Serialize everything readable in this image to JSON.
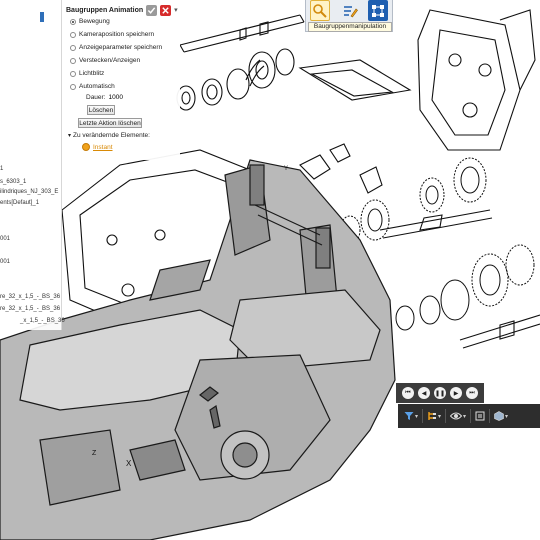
{
  "tree": {
    "rows": [
      "1",
      "s_6303_1",
      "ilindriques_NJ_303_E",
      "ents[Defaut]_1",
      "001",
      "001",
      "re_32_x_1,5_-_BS_36",
      "re_32_x_1,5_-_BS_36",
      "_x_1,5_-_BS_36"
    ]
  },
  "animation_panel": {
    "title": "Baugruppen Animation",
    "options": [
      {
        "label": "Bewegung",
        "selected": true
      },
      {
        "label": "Kameraposition speichern",
        "selected": false
      },
      {
        "label": "Anzeigeparameter speichern",
        "selected": false
      },
      {
        "label": "Verstecken/Anzeigen",
        "selected": false
      },
      {
        "label": "Lichtblitz",
        "selected": false
      },
      {
        "label": "Automatisch",
        "selected": false
      }
    ],
    "duration_label": "Dauer:",
    "duration_value": "1000",
    "delete_label": "Löschen",
    "undo_label": "Letzte Aktion löschen",
    "elements_label": "Zu verändernde Elemente:",
    "instant_label": "Instant"
  },
  "manipulation": {
    "tooltip": "Baugruppenmanipulation",
    "buttons": [
      "search-move-icon",
      "edit-list-icon",
      "assembly-grid-icon"
    ]
  },
  "playback": {
    "buttons": [
      "skip-back",
      "rewind",
      "pause",
      "forward",
      "skip-forward"
    ]
  },
  "toolbar": {
    "items": [
      "filter-icon",
      "tree-icon",
      "visibility-icon",
      "layers-icon",
      "cube-icon"
    ]
  },
  "colors": {
    "accent_orange": "#f0a21c",
    "cancel_red": "#d62b2b",
    "toolbar_dark": "#2d2d2d",
    "toolbar_blue": "#1f5fb0"
  }
}
